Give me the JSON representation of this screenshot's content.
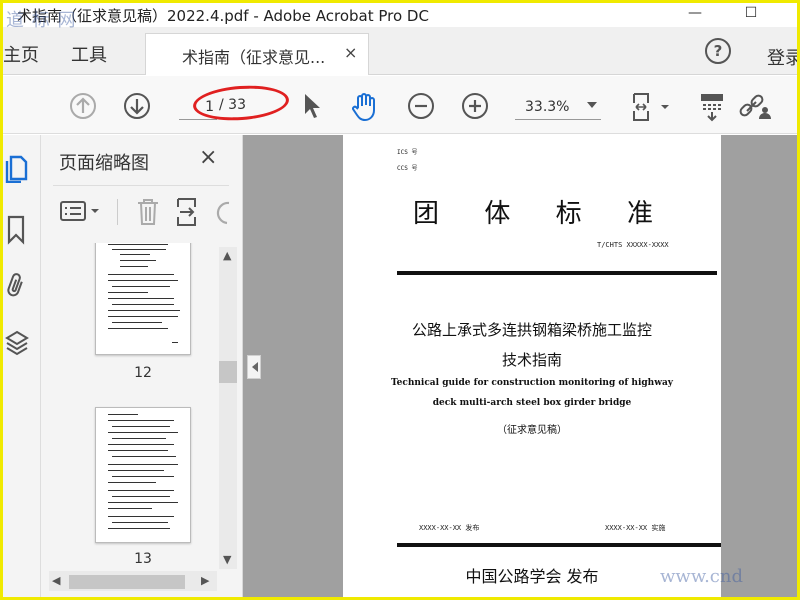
{
  "window": {
    "title": "术指南（征求意见稿）2022.4.pdf - Adobe Acrobat Pro DC",
    "minimize_glyph": "—",
    "maximize_glyph": "☐"
  },
  "tabs": {
    "home": "主页",
    "tools": "工具",
    "document": "术指南（征求意见...",
    "close_glyph": "×",
    "help_glyph": "?",
    "login": "登录"
  },
  "toolbar": {
    "page_current": "1",
    "page_total": "/ 33",
    "zoom": "33.3%"
  },
  "thumbnails_panel": {
    "title": "页面缩略图",
    "close_glyph": "×",
    "pages": [
      {
        "label": "12"
      },
      {
        "label": "13"
      }
    ]
  },
  "document_page": {
    "ics": "ICS 号",
    "ccs": "CCS 号",
    "heading_chars": [
      "团",
      "体",
      "标",
      "准"
    ],
    "standard_number": "T/CHTS XXXXX-XXXX",
    "title_cn_line1": "公路上承式多连拱钢箱梁桥施工监控",
    "title_cn_line2": "技术指南",
    "title_en_line1": "Technical guide for construction monitoring of highway",
    "title_en_line2": "deck multi-arch steel box girder bridge",
    "draft_label": "（征求意见稿）",
    "publish_date": "XXXX-XX-XX 发布",
    "implement_date": "XXXX-XX-XX 实施",
    "publisher": "中国公路学会  发布"
  },
  "watermarks": {
    "top_left": "道 标 网",
    "bottom_right": "www.cnd"
  },
  "colors": {
    "accent_blue": "#1a6fd4",
    "annotation_red": "#e02020",
    "screen_border": "#f0ea00"
  }
}
